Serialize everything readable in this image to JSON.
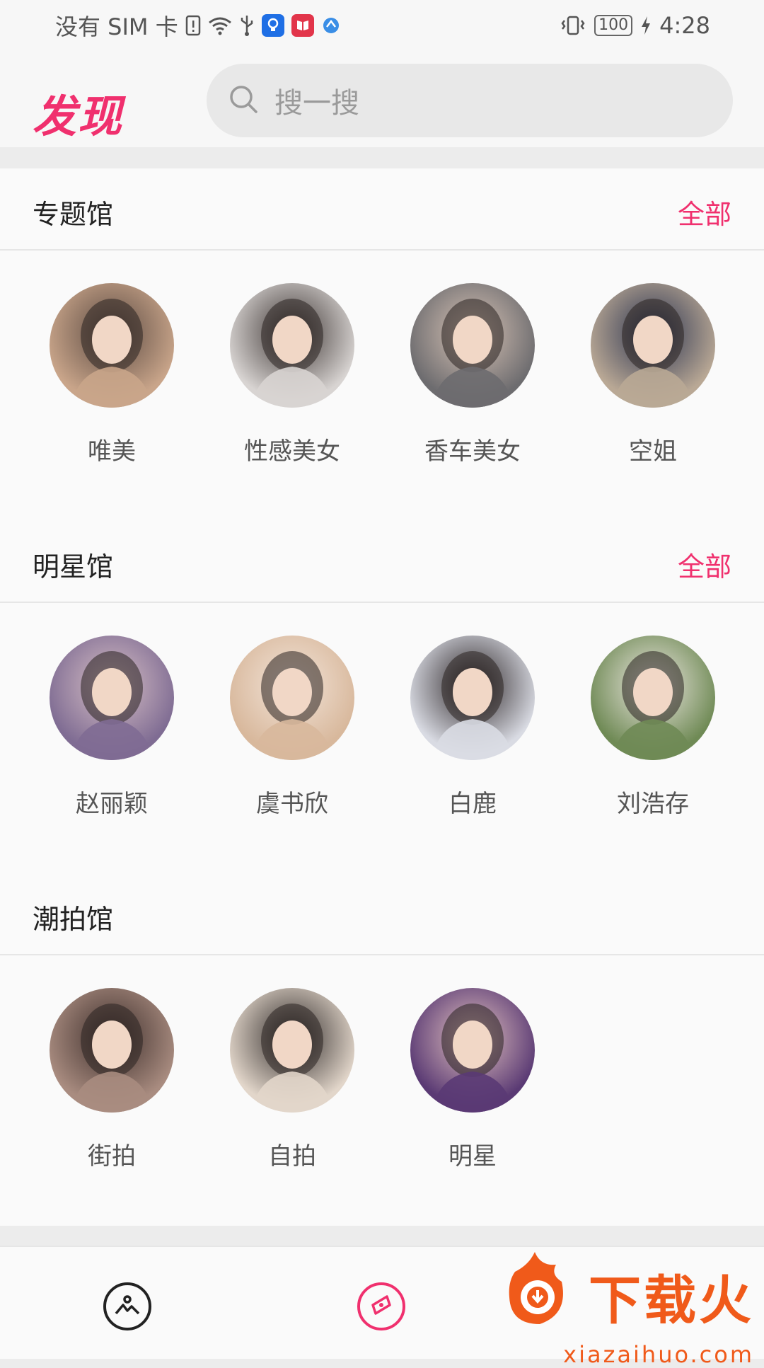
{
  "status_bar": {
    "carrier": "没有 SIM 卡",
    "battery": "100",
    "time": "4:28",
    "icons": [
      "sim-alert-icon",
      "wifi-icon",
      "usb-icon",
      "notification-app-icon",
      "book-app-icon",
      "browser-app-icon",
      "vibrate-icon",
      "charging-icon"
    ]
  },
  "header": {
    "title": "发现",
    "search_placeholder": "搜一搜"
  },
  "sections": [
    {
      "title": "专题馆",
      "all_label": "全部",
      "items": [
        {
          "label": "唯美",
          "colors": [
            "#c9a58a",
            "#5b4a42"
          ]
        },
        {
          "label": "性感美女",
          "colors": [
            "#d8d4d2",
            "#3c3432"
          ]
        },
        {
          "label": "香车美女",
          "colors": [
            "#6d6c6f",
            "#d9c4b6"
          ]
        },
        {
          "label": "空姐",
          "colors": [
            "#b9a895",
            "#2a3350"
          ]
        }
      ]
    },
    {
      "title": "明星馆",
      "all_label": "全部",
      "items": [
        {
          "label": "赵丽颖",
          "colors": [
            "#7f6c93",
            "#d9c1c6"
          ]
        },
        {
          "label": "虞书欣",
          "colors": [
            "#d8b89c",
            "#f3e5da"
          ]
        },
        {
          "label": "白鹿",
          "colors": [
            "#d9dbe3",
            "#2b2426"
          ]
        },
        {
          "label": "刘浩存",
          "colors": [
            "#6f8a55",
            "#efe9e4"
          ]
        }
      ]
    },
    {
      "title": "潮拍馆",
      "all_label": "",
      "items": [
        {
          "label": "街拍",
          "colors": [
            "#a98c80",
            "#3d2e2b"
          ]
        },
        {
          "label": "自拍",
          "colors": [
            "#e2d6ca",
            "#2f2a29"
          ]
        },
        {
          "label": "明星",
          "colors": [
            "#5a3a74",
            "#e4c3c0"
          ]
        }
      ]
    }
  ],
  "tabbar": {
    "tabs": [
      {
        "icon": "gallery-icon",
        "active": false
      },
      {
        "icon": "discover-compass-icon",
        "active": true
      }
    ]
  },
  "watermark": {
    "main": "下载火",
    "sub": "xiazaihuo.com"
  },
  "colors": {
    "accent": "#f0306e",
    "background": "#fafafa",
    "divider": "#ececec"
  }
}
